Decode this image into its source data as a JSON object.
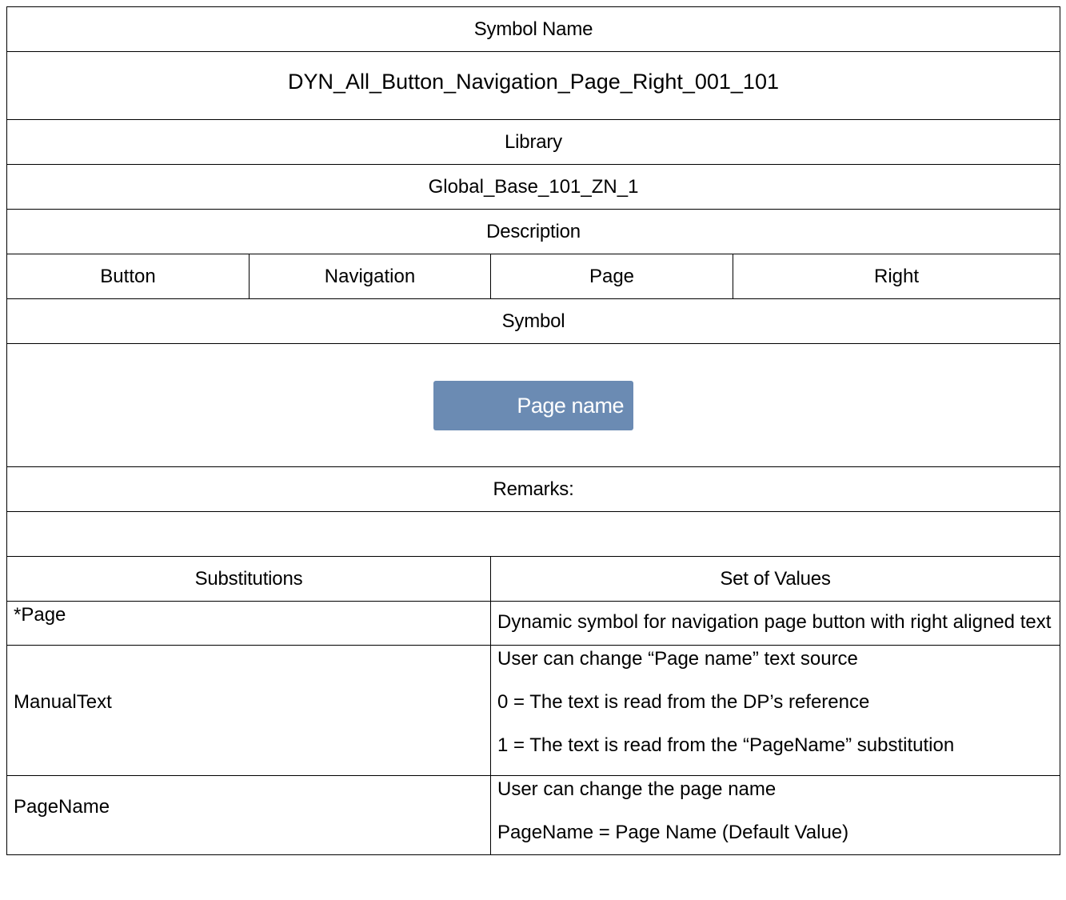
{
  "symbol_name": {
    "header": "Symbol Name",
    "value": "DYN_All_Button_Navigation_Page_Right_001_101"
  },
  "library": {
    "header": "Library",
    "value": "Global_Base_101_ZN_1"
  },
  "description": {
    "header": "Description",
    "items": [
      "Button",
      "Navigation",
      "Page",
      "Right"
    ]
  },
  "symbol": {
    "header": "Symbol",
    "button_label": "Page name",
    "button_color": "#6b8bb3"
  },
  "remarks": {
    "header": "Remarks:",
    "value": ""
  },
  "substitutions": {
    "col_substitutions": "Substitutions",
    "col_values": "Set of Values",
    "rows": [
      {
        "name": "*Page",
        "values": [
          "Dynamic symbol for navigation page button with right aligned text"
        ]
      },
      {
        "name": "ManualText",
        "values": [
          "User can change “Page name” text source",
          "0 = The text is read from the DP’s reference",
          "1 = The text is read from the  “PageName” substitution"
        ]
      },
      {
        "name": "PageName",
        "values": [
          "User can change the page name",
          "PageName = Page Name (Default Value)"
        ]
      }
    ]
  }
}
